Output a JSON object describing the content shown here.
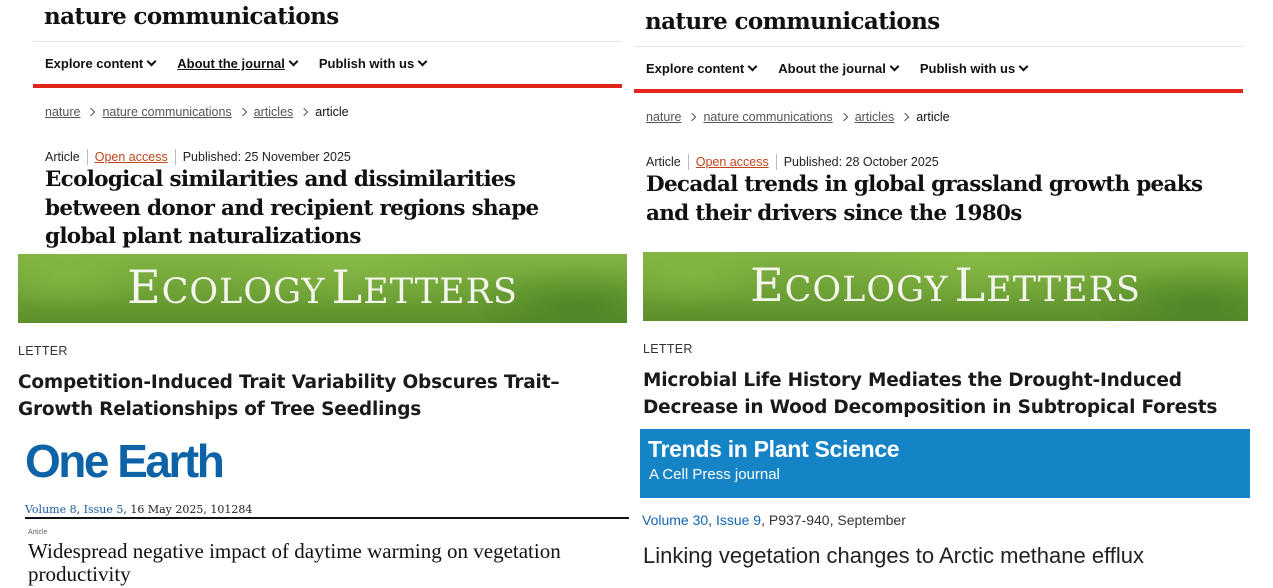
{
  "nature_left": {
    "logo": "nature communications",
    "nav": [
      {
        "label": "Explore content"
      },
      {
        "label": "About the journal"
      },
      {
        "label": "Publish with us"
      }
    ],
    "breadcrumb": [
      "nature",
      "nature communications",
      "articles",
      "article"
    ],
    "article_type": "Article",
    "access": "Open access",
    "published": "Published: 25 November 2025",
    "title": "Ecological similarities and dissimilarities between donor and recipient regions shape global plant naturalizations"
  },
  "nature_right": {
    "logo": "nature communications",
    "nav": [
      {
        "label": "Explore content"
      },
      {
        "label": "About the journal"
      },
      {
        "label": "Publish with us"
      }
    ],
    "breadcrumb": [
      "nature",
      "nature communications",
      "articles",
      "article"
    ],
    "article_type": "Article",
    "access": "Open access",
    "published": "Published: 28 October 2025",
    "title": "Decadal trends in global grassland growth peaks and their drivers since the 1980s"
  },
  "ecology_left": {
    "banner_e": "E",
    "banner_cology": "COLOGY",
    "banner_l": "L",
    "banner_etters": "ETTERS",
    "label": "LETTER",
    "title": "Competition-Induced Trait Variability Obscures Trait–Growth Relationships of Tree Seedlings"
  },
  "ecology_right": {
    "banner_e": "E",
    "banner_cology": "COLOGY",
    "banner_l": "L",
    "banner_etters": "ETTERS",
    "label": "LETTER",
    "title": "Microbial Life History Mediates the Drought-Induced Decrease in Wood Decomposition in Subtropical Forests"
  },
  "one_earth": {
    "logo": "One Earth",
    "volume": "Volume 8",
    "issue": "Issue 5",
    "date_id": ", 16 May 2025, 101284",
    "article_type": "Article",
    "title": "Widespread negative impact of daytime warming on vegetation productivity"
  },
  "trends": {
    "name": "Trends in Plant Science",
    "subtitle": "A Cell Press journal",
    "volume": "Volume 30",
    "issue": "Issue 9",
    "pages": ", P937-940, September",
    "title": "Linking vegetation changes to Arctic methane efflux"
  },
  "colors": {
    "nature_red": "#e1251b",
    "ecology_green": "#6fa236",
    "one_earth_blue": "#0e63a8",
    "trends_blue": "#1584c6",
    "open_access": "#c0471a"
  },
  "icons": [
    "chevron-down-icon",
    "chevron-right-icon"
  ]
}
